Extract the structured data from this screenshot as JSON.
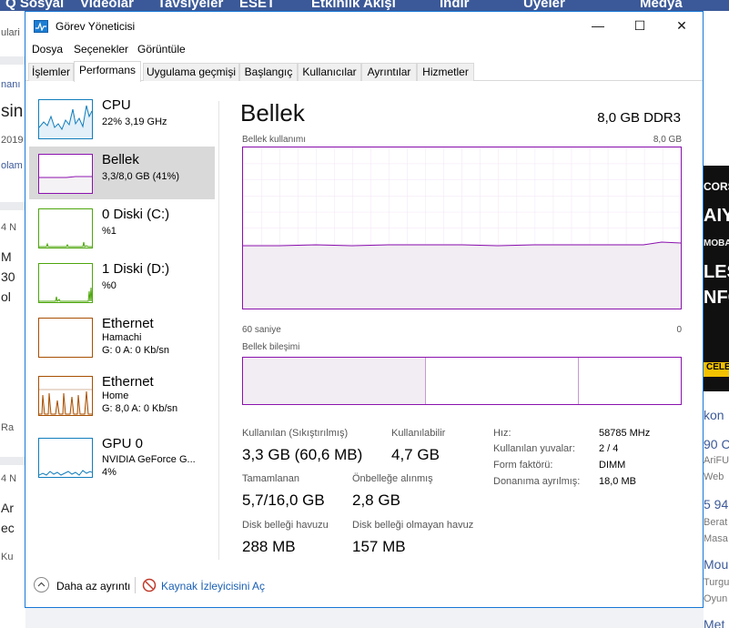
{
  "background": {
    "nav": [
      "Q Sosyal",
      "Videolar",
      "Tavsiyeler",
      "ESET",
      "Etkinlik Akışı",
      "İndir",
      "Üyeler",
      "Medya"
    ],
    "left_fragments": [
      "ulari",
      "nanı",
      "sin",
      "2019",
      "olam",
      "4 N",
      "M",
      "30",
      "ol",
      "Ra",
      "4 N",
      "Ar",
      "ec",
      "Ku"
    ],
    "right_fragments": [
      "kon",
      "90 C",
      "AriFU",
      "Web",
      "5 94",
      "Berat",
      "Masa",
      "Mou",
      "Turgu",
      "Oyun",
      "Met"
    ],
    "ad_text": [
      "CORS",
      "AIY",
      "MOBA",
      "LES",
      "NFO",
      "CELE"
    ]
  },
  "window": {
    "title": "Görev Yöneticisi",
    "controls": {
      "minimize": "—",
      "maximize": "☐",
      "close": "✕"
    }
  },
  "menu": [
    "Dosya",
    "Seçenekler",
    "Görüntüle"
  ],
  "tabs": [
    "İşlemler",
    "Performans",
    "Uygulama geçmişi",
    "Başlangıç",
    "Kullanıcılar",
    "Ayrıntılar",
    "Hizmetler"
  ],
  "active_tab": "Performans",
  "sidebar": [
    {
      "title": "CPU",
      "sub1": "22%  3,19 GHz",
      "sub2": "",
      "color": "#117dbb"
    },
    {
      "title": "Bellek",
      "sub1": "3,3/8,0 GB (41%)",
      "sub2": "",
      "color": "#8b12ae"
    },
    {
      "title": "0 Diski (C:)",
      "sub1": "%1",
      "sub2": "",
      "color": "#4da60c"
    },
    {
      "title": "1 Diski (D:)",
      "sub1": "%0",
      "sub2": "",
      "color": "#4da60c"
    },
    {
      "title": "Ethernet",
      "sub1": "Hamachi",
      "sub2": "G: 0  A: 0 Kb/sn",
      "color": "#a74f01"
    },
    {
      "title": "Ethernet",
      "sub1": "Home",
      "sub2": "G: 8,0  A: 0 Kb/sn",
      "color": "#a74f01"
    },
    {
      "title": "GPU 0",
      "sub1": "NVIDIA GeForce G...",
      "sub2": "4%",
      "color": "#117dbb"
    }
  ],
  "main": {
    "title": "Bellek",
    "spec": "8,0 GB DDR3",
    "usage_label": "Bellek kullanımı",
    "usage_max": "8,0 GB",
    "x_left": "60 saniye",
    "x_right": "0",
    "composition_label": "Bellek bileşimi",
    "usage_fraction": 0.41,
    "stats": {
      "in_use_label": "Kullanılan (Sıkıştırılmış)",
      "in_use_value": "3,3 GB (60,6 MB)",
      "available_label": "Kullanılabilir",
      "available_value": "4,7 GB",
      "committed_label": "Tamamlanan",
      "committed_value": "5,7/16,0 GB",
      "cached_label": "Önbelleğe alınmış",
      "cached_value": "2,8 GB",
      "paged_label": "Disk belleği havuzu",
      "paged_value": "288 MB",
      "nonpaged_label": "Disk belleği olmayan havuz",
      "nonpaged_value": "157 MB"
    },
    "details": [
      {
        "label": "Hız:",
        "value": "58785 MHz"
      },
      {
        "label": "Kullanılan yuvalar:",
        "value": "2 / 4"
      },
      {
        "label": "Form faktörü:",
        "value": "DIMM"
      },
      {
        "label": "Donanıma ayrılmış:",
        "value": "18,0 MB"
      }
    ]
  },
  "footer": {
    "less_details": "Daha az ayrıntı",
    "resource_monitor": "Kaynak İzleyicisini Aç"
  }
}
